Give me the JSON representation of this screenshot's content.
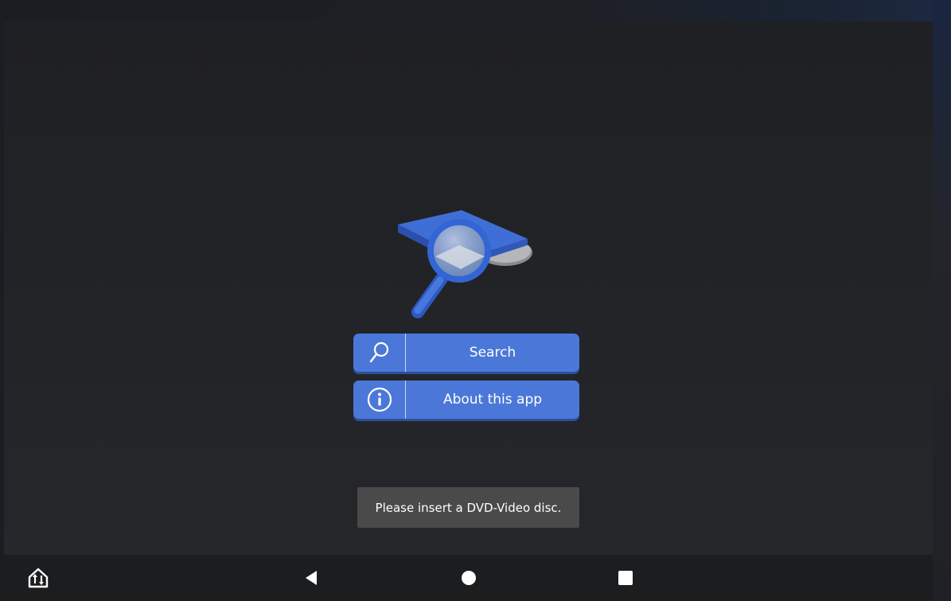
{
  "app": {
    "logo_icon": "dvd-search-magnifier-icon",
    "accent_color": "#4b78d8"
  },
  "menu": {
    "search": {
      "label": "Search",
      "icon": "search-icon"
    },
    "about": {
      "label": "About this app",
      "icon": "info-icon"
    }
  },
  "toast": {
    "message": "Please insert a DVD-Video disc."
  },
  "navbar": {
    "items": [
      {
        "name": "app-home-icon"
      },
      {
        "name": "back-icon"
      },
      {
        "name": "home-icon"
      },
      {
        "name": "recents-icon"
      }
    ]
  }
}
